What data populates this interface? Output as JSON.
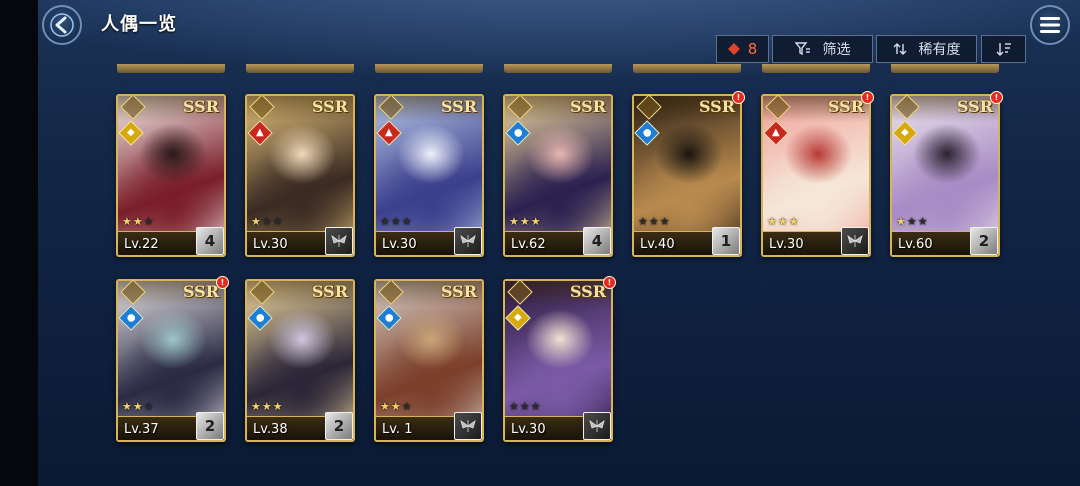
{
  "header": {
    "title": "人偶一览",
    "back_icon": "back-arrow-icon",
    "menu_icon": "hamburger-menu-icon"
  },
  "toolbar": {
    "count": "8",
    "count_icon": "diamond-icon",
    "filter_label": "筛选",
    "filter_icon": "filter-icon",
    "rarity_label": "稀有度",
    "rarity_icon": "sort-arrows-icon",
    "order_icon": "sort-descending-icon"
  },
  "colors": {
    "fire": "#c9281f",
    "water": "#1c7ed6",
    "light": "#d6a90e",
    "frame_gold": "#d9b457",
    "count_red": "#ff6a3d"
  },
  "characters": [
    {
      "rarity": "SSR",
      "element": "light",
      "stars": 2,
      "level": "Lv.22",
      "badge": "4",
      "alert": false,
      "palette": [
        "#f3ede8",
        "#7a1d2a",
        "#2a1a1a"
      ]
    },
    {
      "rarity": "SSR",
      "element": "fire",
      "stars": 1,
      "level": "Lv.30",
      "badge": "",
      "alert": false,
      "palette": [
        "#e3c27c",
        "#3a2a22",
        "#f0d8b8"
      ]
    },
    {
      "rarity": "SSR",
      "element": "fire",
      "stars": 0,
      "level": "Lv.30",
      "badge": "",
      "alert": false,
      "palette": [
        "#b7c8e6",
        "#3c3f8c",
        "#eef2fb"
      ]
    },
    {
      "rarity": "SSR",
      "element": "water",
      "stars": 3,
      "level": "Lv.62",
      "badge": "4",
      "alert": false,
      "palette": [
        "#f2d9a0",
        "#2b2150",
        "#e7b6b0"
      ]
    },
    {
      "rarity": "SSR",
      "element": "water",
      "stars": 0,
      "level": "Lv.40",
      "badge": "1",
      "alert": true,
      "palette": [
        "#2a2016",
        "#b98a4e",
        "#1a1510"
      ]
    },
    {
      "rarity": "SSR",
      "element": "fire",
      "stars": 3,
      "level": "Lv.30",
      "badge": "",
      "alert": true,
      "palette": [
        "#f0a19a",
        "#f5e7d8",
        "#b83a36"
      ]
    },
    {
      "rarity": "SSR",
      "element": "light",
      "stars": 1,
      "level": "Lv.60",
      "badge": "2",
      "alert": true,
      "palette": [
        "#ece4ec",
        "#a78bc5",
        "#2b2230"
      ]
    },
    {
      "rarity": "SSR",
      "element": "water",
      "stars": 2,
      "level": "Lv.37",
      "badge": "2",
      "alert": true,
      "palette": [
        "#e8e4e6",
        "#2a2a44",
        "#9fc6c9"
      ]
    },
    {
      "rarity": "SSR",
      "element": "water",
      "stars": 3,
      "level": "Lv.38",
      "badge": "2",
      "alert": false,
      "palette": [
        "#f2d9a0",
        "#2b2638",
        "#cfc7e0"
      ]
    },
    {
      "rarity": "SSR",
      "element": "water",
      "stars": 2,
      "level": "Lv. 1",
      "badge": "",
      "alert": false,
      "palette": [
        "#d8cec6",
        "#7b3f2a",
        "#c9a67a"
      ]
    },
    {
      "rarity": "SSR",
      "element": "light",
      "stars": 0,
      "level": "Lv.30",
      "badge": "",
      "alert": true,
      "palette": [
        "#2a1a3c",
        "#7a5aa6",
        "#f1e0d0"
      ]
    }
  ]
}
